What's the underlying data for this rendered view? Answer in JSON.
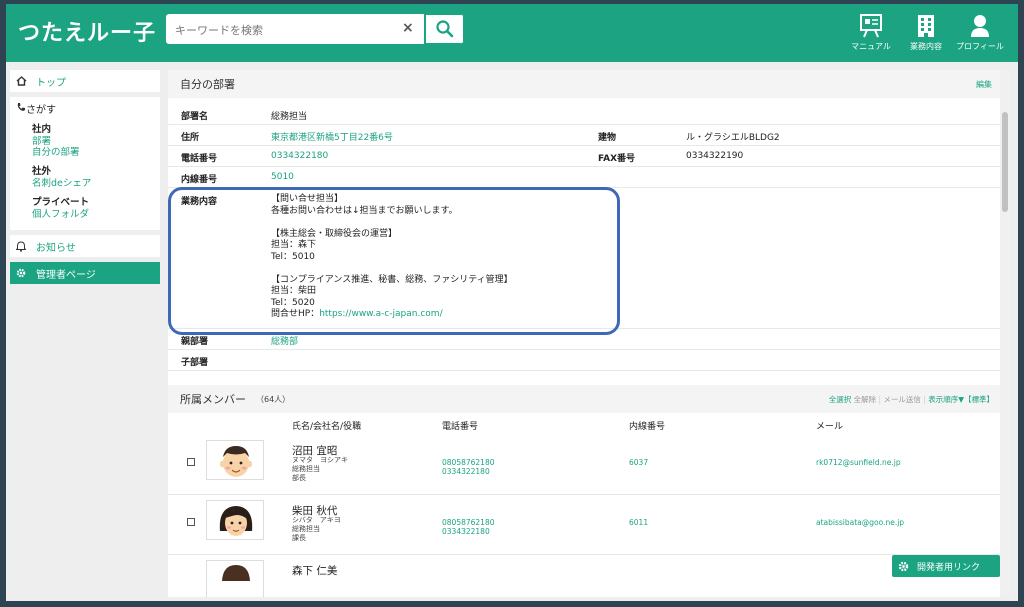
{
  "app": {
    "title": "つたえルー子"
  },
  "search": {
    "placeholder": "キーワードを検索",
    "clear": "×"
  },
  "nav": [
    {
      "label": "マニュアル",
      "icon": "manual-board-icon"
    },
    {
      "label": "業務内容",
      "icon": "building-icon"
    },
    {
      "label": "プロフィール",
      "icon": "person-icon"
    }
  ],
  "sidebar": {
    "top": "トップ",
    "search_title": "さがす",
    "internal": {
      "title": "社内",
      "links": [
        "部署",
        "自分の部署"
      ]
    },
    "external": {
      "title": "社外",
      "links": [
        "名刺deシェア"
      ]
    },
    "private": {
      "title": "プライベート",
      "links": [
        "個人フォルダ"
      ]
    },
    "notice": "お知らせ",
    "admin": "管理者ページ"
  },
  "dept": {
    "section_title": "自分の部署",
    "edit": "編集",
    "name_label": "部署名",
    "name": "総務担当",
    "address_label": "住所",
    "address": "東京都港区新橋5丁目22番6号",
    "building_label": "建物",
    "building": "ル・グラシエルBLDG2",
    "phone_label": "電話番号",
    "phone": "0334322180",
    "fax_label": "FAX番号",
    "fax": "0334322190",
    "ext_label": "内線番号",
    "ext": "5010",
    "duties_label": "業務内容",
    "duties_lines": [
      "【問い合せ担当】",
      "各種お問い合わせは↓担当までお願いします。",
      "",
      "【株主総会・取締役会の運営】",
      "担当：森下",
      "Tel：5010",
      "",
      "【コンプライアンス推進、秘書、総務、ファシリティ管理】",
      "担当：柴田",
      "Tel：5020"
    ],
    "duties_hp_label": "問合せHP：",
    "duties_hp": "https://www.a-c-japan.com/",
    "parent_label": "親部署",
    "parent": "総務部",
    "child_label": "子部署"
  },
  "members": {
    "title": "所属メンバー",
    "count": "（64人）",
    "tools": {
      "select_all": "全選択",
      "deselect": "全解除",
      "mail": "メール送信",
      "order": "表示順序▼【標準】"
    },
    "columns": {
      "name": "氏名/会社名/役職",
      "phone": "電話番号",
      "ext": "内線番号",
      "mail": "メール"
    },
    "rows": [
      {
        "name": "沼田 宜昭",
        "kana": "ヌマタ　ヨシアキ",
        "dept": "総務担当",
        "title": "部長",
        "mobile": "08058762180",
        "phone": "0334322180",
        "ext": "6037",
        "mail": "rk0712@sunfield.ne.jp"
      },
      {
        "name": "柴田 秋代",
        "kana": "シバタ　アキヨ",
        "dept": "総務担当",
        "title": "課長",
        "mobile": "08058762180",
        "phone": "0334322180",
        "ext": "6011",
        "mail": "atabissibata@goo.ne.jp"
      },
      {
        "name": "森下 仁美",
        "kana": "",
        "dept": "",
        "title": "",
        "mobile": "",
        "phone": "",
        "ext": "",
        "mail": ""
      }
    ]
  },
  "devlink": "開発者用リンク",
  "colors": {
    "brand": "#1ba382",
    "highlight": "#3f69b6"
  }
}
